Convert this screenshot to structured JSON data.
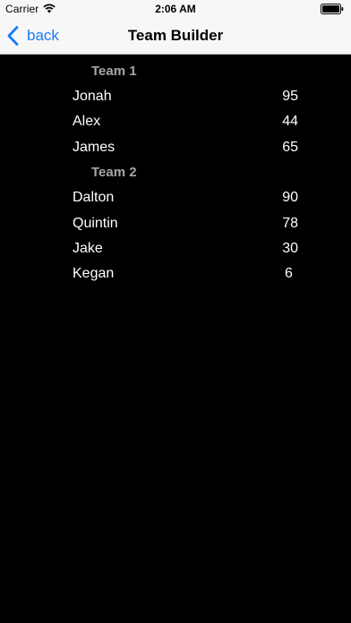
{
  "status_bar": {
    "carrier": "Carrier",
    "time": "2:06 AM",
    "wifi_icon": "wifi-icon",
    "battery_icon": "battery-icon"
  },
  "nav_bar": {
    "back_label": "back",
    "back_icon": "chevron-left-icon",
    "title": "Team Builder",
    "accent_color": "#1a7cf5"
  },
  "teams": [
    {
      "name": "Team 1",
      "players": [
        {
          "name": "Jonah",
          "score": "95"
        },
        {
          "name": "Alex",
          "score": "44"
        },
        {
          "name": "James",
          "score": "65"
        }
      ]
    },
    {
      "name": "Team 2",
      "players": [
        {
          "name": "Dalton",
          "score": "90"
        },
        {
          "name": "Quintin",
          "score": "78"
        },
        {
          "name": "Jake",
          "score": "30"
        },
        {
          "name": "Kegan",
          "score": "6"
        }
      ]
    }
  ],
  "colors": {
    "background": "#000000",
    "row_text": "#ffffff",
    "section_header": "#a6a6a6",
    "nav_background": "#f7f7f7"
  }
}
